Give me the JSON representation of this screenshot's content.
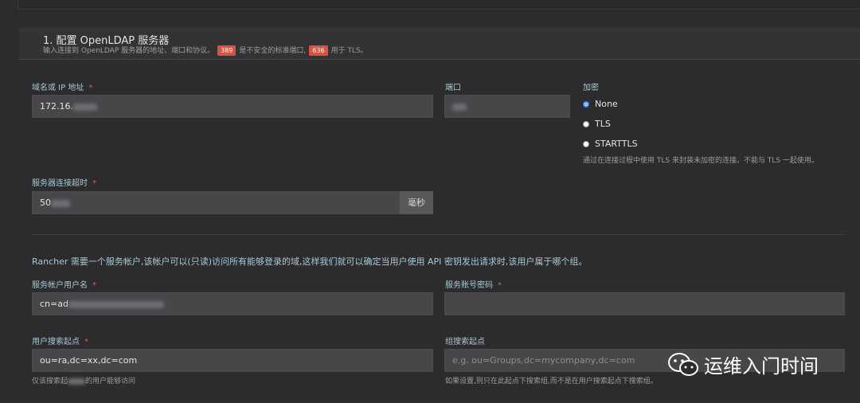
{
  "section": {
    "title": "1. 配置 OpenLDAP 服务器",
    "desc_before": "输入连接到 OpenLDAP 服务器的地址、端口和协议。",
    "port_insecure": "389",
    "desc_middle": "是不安全的标准端口,",
    "port_tls": "636",
    "desc_after": "用于 TLS。"
  },
  "host": {
    "label": "域名或 IP 地址",
    "value": "172.16."
  },
  "port": {
    "label": "端口",
    "value": ""
  },
  "encryption": {
    "label": "加密",
    "options": [
      "None",
      "TLS",
      "STARTTLS"
    ],
    "selected": "None",
    "hint": "通过在连接过程中使用 TLS 来封装未加密的连接。不能与 TLS 一起使用。"
  },
  "timeout": {
    "label": "服务器连接超时",
    "value": "50",
    "suffix": "毫秒"
  },
  "account_desc": "Rancher 需要一个服务帐户,该帐户可以(只读)访问所有能够登录的域,这样我们就可以确定当用户使用 API 密钥发出请求时,该用户属于哪个组。",
  "service_user": {
    "label": "服务帐户用户名",
    "value": "cn=ad"
  },
  "service_password": {
    "label": "服务账号密码",
    "value": ""
  },
  "user_search": {
    "label": "用户搜索起点",
    "value": "ou=ra,dc=xx,dc=com",
    "hint_before": "仅该搜索起",
    "hint_after": "的用户能够访问"
  },
  "group_search": {
    "label": "组搜索起点",
    "placeholder": "e.g. ou=Groups,dc=mycompany,dc=com",
    "hint": "如果设置,则只在此起点下搜索组,而不是在用户搜索起点下搜索组。"
  },
  "watermark": "运维入门时间",
  "required_mark": "*"
}
